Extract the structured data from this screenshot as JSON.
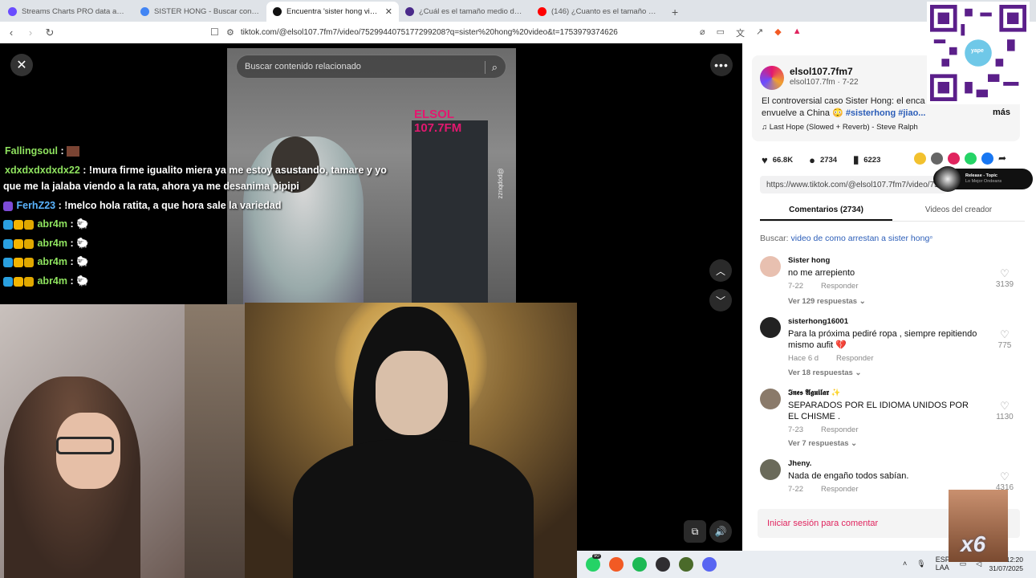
{
  "browser": {
    "tabs": [
      {
        "label": "Streams Charts PRO data access - Str",
        "color": "#6a4cff",
        "active": false
      },
      {
        "label": "SISTER HONG - Buscar con Google",
        "color": "#4285f4",
        "active": false
      },
      {
        "label": "Encuentra 'sister hong video' en",
        "color": "#111111",
        "active": true
      },
      {
        "label": "¿Cuál es el tamaño medio del pene",
        "color": "#4a2a8a",
        "active": false
      },
      {
        "label": "(146) ¿Cuanto es el tamaño promedi",
        "color": "#ff0000",
        "active": false
      }
    ],
    "new_tab": "+",
    "url": "tiktok.com/@elsol107.7fm7/video/7529944075177299208?q=sister%20hong%20video&t=1753979374626",
    "back": "‹",
    "forward": "›",
    "reload": "↻"
  },
  "video": {
    "search_placeholder": "Buscar contenido relacionado",
    "close": "✕",
    "more": "•••",
    "up": "︿",
    "down": "﹀",
    "station_logo": "ELSOL 107.7FM",
    "watermark": "@popbuzz",
    "volume_icon": "🔊",
    "pip_icon": "⧉"
  },
  "chat": [
    {
      "user": "Fallingsoul",
      "sep": " :",
      "msg": "",
      "usercolor": "green"
    },
    {
      "user": "xdxdxdxdxdx22",
      "sep": " :",
      "msg": " !mura firme igualito miera ya me estoy asustando, tamare y yo",
      "usercolor": "green"
    },
    {
      "user": "",
      "sep": "",
      "msg": "que me la jalaba viendo a la rata, ahora ya me desanima pipipi",
      "usercolor": "green"
    },
    {
      "user": "FerhZ23",
      "sep": " :",
      "msg": " !melco hola ratita, a que hora sale la variedad",
      "usercolor": "blue"
    },
    {
      "user": "abr4m",
      "sep": " :",
      "msg": " 🐑",
      "usercolor": "green"
    },
    {
      "user": "abr4m",
      "sep": " :",
      "msg": " 🐑",
      "usercolor": "green"
    },
    {
      "user": "abr4m",
      "sep": " :",
      "msg": " 🐑",
      "usercolor": "green"
    },
    {
      "user": "abr4m",
      "sep": " :",
      "msg": " 🐑",
      "usercolor": "green"
    }
  ],
  "panel": {
    "author": "elsol107.7fm7",
    "author_sub": "elsol107.7fm · 7-22",
    "desc_line1": "El controversial caso Sister Hong: el enca",
    "desc_line2": "envuelve a China 😳 ",
    "tag1": "#sisterhong",
    "tag2": " #jiao...",
    "more": "más",
    "music": "♫  Last Hope (Slowed + Reverb) - Steve Ralph",
    "likes": "66.8K",
    "comments": "2734",
    "saves": "6223",
    "link": "https://www.tiktok.com/@elsol107.7fm7/video/75",
    "tab_comments": "Comentarios (2734)",
    "tab_creator": "Videos del creador",
    "search_prefix": "Buscar: ",
    "search_query": "video de como arrestan a sister hong",
    "login": "Iniciar sesión para comentar"
  },
  "comments": [
    {
      "name": "Sister hong",
      "text": "no me arrepiento",
      "date": "7-22",
      "reply": "Responder",
      "replies": "Ver 129 respuestas ⌄",
      "likes": "3139"
    },
    {
      "name": "sisterhong16001",
      "text": "Para la próxima pediré ropa , siempre repitiendo mismo aufit 💔",
      "date": "Hace 6 d",
      "reply": "Responder",
      "replies": "Ver 18 respuestas ⌄",
      "likes": "775"
    },
    {
      "name": "𝕴𝖓𝖊𝖘 𝕬𝖌𝖚𝖎𝖑𝖆𝖗 ✨",
      "text": "SEPARADOS POR EL IDIOMA UNIDOS POR EL CHISME .",
      "date": "7-23",
      "reply": "Responder",
      "replies": "Ver 7 respuestas ⌄",
      "likes": "1130"
    },
    {
      "name": "Jheny.",
      "text": "Nada de engaño todos sabían.",
      "date": "7-22",
      "reply": "Responder",
      "replies": "",
      "likes": "4316"
    }
  ],
  "overlay": {
    "yape": "yape",
    "mini_title": "Release - Topic",
    "mini_sub": "Lo Mejor Ondeans",
    "x6": "x6"
  },
  "taskbar": {
    "lang1": "ESP",
    "lang2": "LAA",
    "time": "12:20",
    "date": "31/07/2025",
    "badge1": "90"
  }
}
